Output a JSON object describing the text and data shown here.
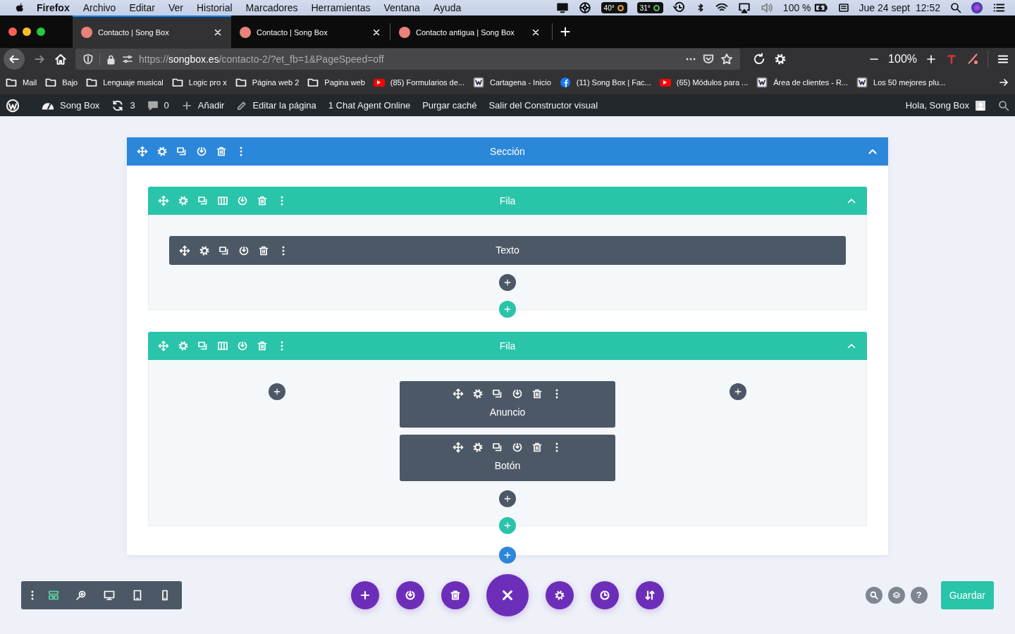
{
  "menubar": {
    "app": "Firefox",
    "menus": [
      "Archivo",
      "Editar",
      "Ver",
      "Historial",
      "Marcadores",
      "Herramientas",
      "Ventana",
      "Ayuda"
    ],
    "temperature_1": "40°",
    "temperature_2": "31°",
    "battery": "100 %",
    "date": "Jue 24 sept",
    "time": "12:52"
  },
  "tabs": [
    {
      "title": "Contacto | Song Box",
      "selected": true
    },
    {
      "title": "Contacto | Song Box",
      "selected": false
    },
    {
      "title": "Contacto antigua | Song Box",
      "selected": false
    }
  ],
  "address": {
    "scheme": "https://",
    "domain": "songbox.es",
    "path": "/contacto-2/?et_fb=1&PageSpeed=off"
  },
  "zoom": "100%",
  "bookmarks": [
    {
      "label": "Mail",
      "kind": "folder"
    },
    {
      "label": "Bajo",
      "kind": "folder"
    },
    {
      "label": "Lenguaje musical",
      "kind": "folder"
    },
    {
      "label": "Logic pro x",
      "kind": "folder"
    },
    {
      "label": "Página web 2",
      "kind": "folder"
    },
    {
      "label": "Pagina web",
      "kind": "folder"
    },
    {
      "label": "(85) Formularios de...",
      "kind": "youtube"
    },
    {
      "label": "Cartagena - Inicio",
      "kind": "site"
    },
    {
      "label": "(11) Song Box | Fac...",
      "kind": "facebook"
    },
    {
      "label": "(65) Módulos para ...",
      "kind": "youtube"
    },
    {
      "label": "Área de clientes - R...",
      "kind": "site"
    },
    {
      "label": "Los 50 mejores plu...",
      "kind": "site"
    }
  ],
  "admin_bar": {
    "items": [
      {
        "label": "Song Box",
        "kind": "site"
      },
      {
        "label": "3",
        "kind": "updates"
      },
      {
        "label": "0",
        "kind": "comments"
      },
      {
        "label": "Añadir",
        "kind": "new"
      },
      {
        "label": "Editar la página",
        "kind": "edit"
      },
      {
        "label": "1 Chat Agent Online",
        "kind": "text"
      },
      {
        "label": "Purgar caché",
        "kind": "text"
      },
      {
        "label": "Salir del Constructor visual",
        "kind": "text"
      }
    ],
    "greeting": "Hola, Song Box"
  },
  "section": {
    "title": "Sección",
    "rows": [
      {
        "title": "Fila",
        "columns": [
          [
            "Texto"
          ]
        ]
      },
      {
        "title": "Fila",
        "columns": [
          [],
          [
            "Anuncio",
            "Botón"
          ],
          []
        ]
      }
    ]
  },
  "view_buttons": [
    {
      "selected": true
    },
    {
      "selected": false
    },
    {
      "selected": false
    },
    {
      "selected": false
    },
    {
      "selected": false
    }
  ],
  "help_label": "?",
  "save_button": "Guardar"
}
